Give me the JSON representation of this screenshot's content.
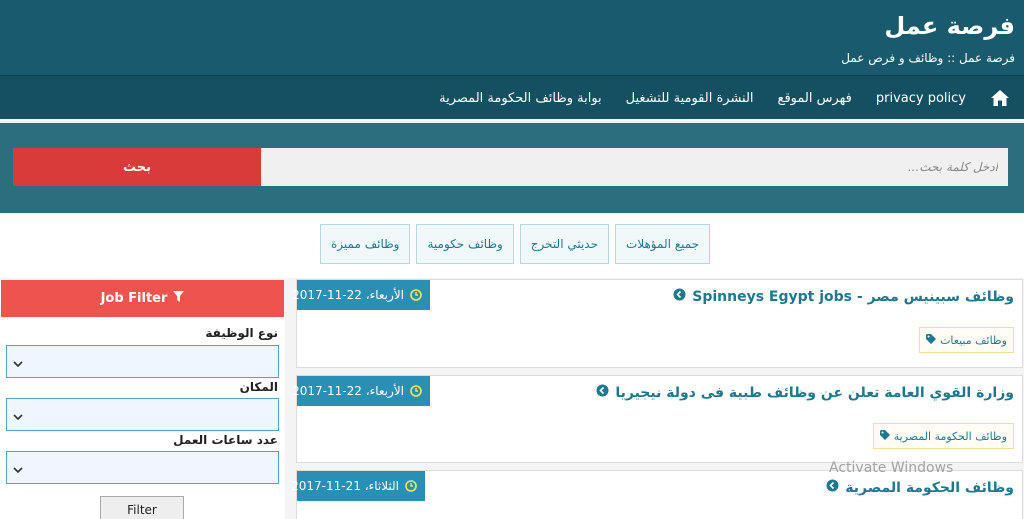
{
  "header": {
    "title": "فرصة عمل",
    "tagline": "فرصة عمل :: وظائف و فرص عمل"
  },
  "nav": {
    "home_icon": "home-icon",
    "items": [
      {
        "label": "privacy policy"
      },
      {
        "label": "فهرس الموقع"
      },
      {
        "label": "النشرة القومية للتشغيل"
      },
      {
        "label": "بوابة وظائف الحكومة المصرية"
      }
    ]
  },
  "search": {
    "placeholder": "ادخل كلمة بحث...",
    "button_label": "بحث"
  },
  "qualification_tabs": [
    {
      "label": "جميع المؤهلات"
    },
    {
      "label": "حديثي التخرج"
    },
    {
      "label": "وظائف حكومية"
    },
    {
      "label": "وظائف مميزة"
    }
  ],
  "filter": {
    "title": "Job Filter",
    "job_type_label": "نوع الوظيفة",
    "location_label": "المكان",
    "hours_label": "عدد ساعات العمل",
    "button_label": "Filter"
  },
  "jobs": [
    {
      "title": "وظائف سبينيس مصر - Spinneys Egypt jobs",
      "date": "الأربعاء، 22-11-2017",
      "tag": "وظائف مبيعات"
    },
    {
      "title": "وزارة القوي العامة تعلن عن وظائف طبية فى دولة نيجيريا",
      "date": "الأربعاء، 22-11-2017",
      "tag": "وظائف الحكومة المصرية"
    },
    {
      "title": "وظائف الحكومة المصرية",
      "date": "الثلاثاء، 21-11-2017",
      "tag": ""
    }
  ],
  "watermark": "Activate Windows",
  "colors": {
    "header": "#1a5a6e",
    "nav": "#155062",
    "search_band": "#2c6e7e",
    "search_button": "#d93a3a",
    "filter_header": "#ef5350",
    "date_badge": "#2a8fb5",
    "link": "#1e7891"
  }
}
